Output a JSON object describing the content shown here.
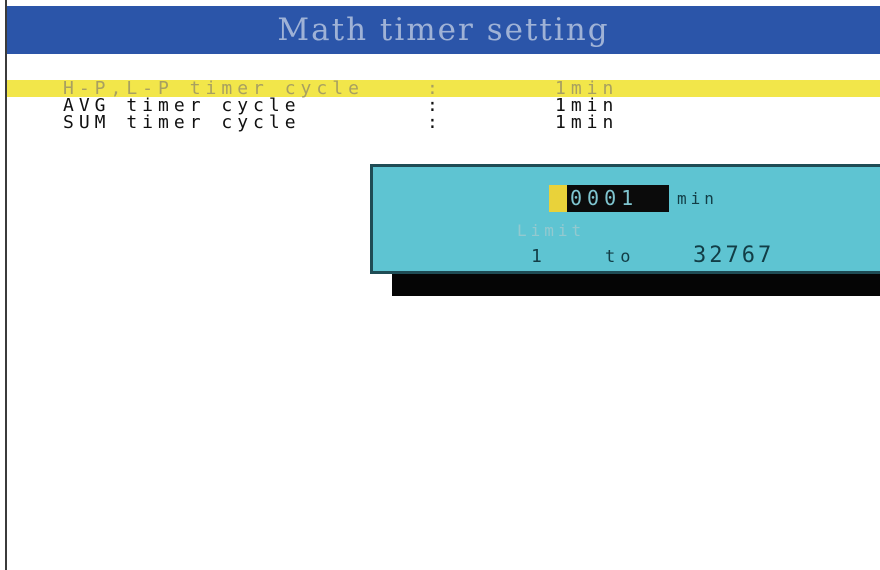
{
  "window": {
    "title": "Math timer setting"
  },
  "settings": [
    {
      "label": "H-P,L-P timer cycle",
      "colon": ":",
      "value": "1min",
      "selected": true
    },
    {
      "label": "AVG timer cycle",
      "colon": ":",
      "value": "1min",
      "selected": false
    },
    {
      "label": "SUM timer cycle",
      "colon": ":",
      "value": "1min",
      "selected": false
    }
  ],
  "popup": {
    "entry": {
      "cursor_digit": "0",
      "remaining_digits": "0001",
      "unit": "min"
    },
    "limit": {
      "label": "Limit",
      "min": "1",
      "to": "to",
      "max": "32767"
    }
  },
  "colors": {
    "title_bar": "#2b55a9",
    "title_text": "#9fb2d6",
    "selection": "#f2e64a",
    "popup_background": "#5ec4d2",
    "entry_background": "#0b0b0b",
    "cursor": "#e9d23a"
  }
}
